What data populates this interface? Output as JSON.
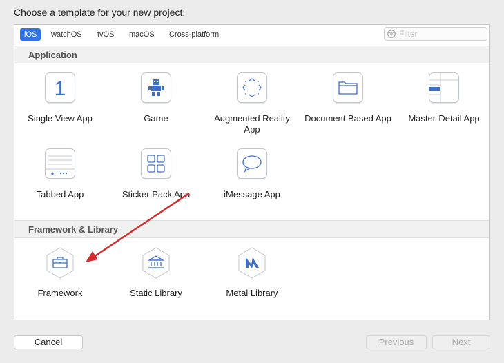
{
  "dialog": {
    "title": "Choose a template for your new project:"
  },
  "tabs": [
    "iOS",
    "watchOS",
    "tvOS",
    "macOS",
    "Cross-platform"
  ],
  "active_tab": "iOS",
  "filter": {
    "placeholder": "Filter"
  },
  "sections": {
    "application": {
      "title": "Application",
      "items": [
        {
          "label": "Single View App",
          "icon": "single-view-app-icon"
        },
        {
          "label": "Game",
          "icon": "game-icon"
        },
        {
          "label": "Augmented Reality App",
          "icon": "augmented-reality-icon"
        },
        {
          "label": "Document Based App",
          "icon": "folder-icon"
        },
        {
          "label": "Master-Detail App",
          "icon": "master-detail-icon"
        },
        {
          "label": "Tabbed App",
          "icon": "tabbed-app-icon"
        },
        {
          "label": "Sticker Pack App",
          "icon": "sticker-grid-icon"
        },
        {
          "label": "iMessage App",
          "icon": "message-bubble-icon"
        }
      ]
    },
    "framework": {
      "title": "Framework & Library",
      "items": [
        {
          "label": "Framework",
          "icon": "toolbox-icon"
        },
        {
          "label": "Static Library",
          "icon": "library-building-icon"
        },
        {
          "label": "Metal Library",
          "icon": "metal-icon"
        }
      ]
    }
  },
  "buttons": {
    "cancel": "Cancel",
    "previous": "Previous",
    "next": "Next"
  },
  "annotation": {
    "arrow_color": "#d42c2c"
  },
  "colors": {
    "accent": "#2f73e6",
    "icon_blue": "#3e6fc9"
  }
}
